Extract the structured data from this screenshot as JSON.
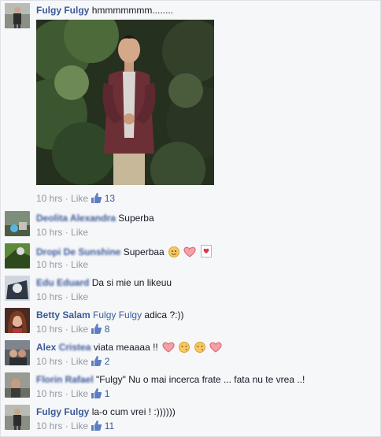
{
  "post": {
    "author": "Fulgy Fulgy",
    "text": "hmmmmmmm........",
    "time": "10 hrs",
    "sep": "·",
    "like_label": "Like",
    "like_count": "13"
  },
  "comments": [
    {
      "author": "Deolita Alexandra",
      "text": "Superba",
      "time": "10 hrs",
      "like_label": "Like",
      "like_count": ""
    },
    {
      "author": "Dropi De Sunshine",
      "text": "Superbaa",
      "time": "10 hrs",
      "like_label": "Like",
      "like_count": ""
    },
    {
      "author": "Edu Eduard",
      "text": "Da si mie un likeuu",
      "time": "10 hrs",
      "like_label": "Like",
      "like_count": ""
    },
    {
      "author": "Betty Salam",
      "mention": "Fulgy Fulgy",
      "text": "adica ?:))",
      "time": "10 hrs",
      "like_label": "Like",
      "like_count": "8"
    },
    {
      "author": "Alex Cristea",
      "text": "viata meaaaa !!",
      "time": "10 hrs",
      "like_label": "Like",
      "like_count": "2"
    },
    {
      "author": "Florin Rafael",
      "text": "\"Fulgy\" Nu o mai incerca frate ... fata nu te vrea ..!",
      "time": "10 hrs",
      "like_label": "Like",
      "like_count": "1"
    },
    {
      "author": "Fulgy Fulgy",
      "text": "la-o cum vrei ! :))))))",
      "time": "10 hrs",
      "like_label": "Like",
      "like_count": "11"
    }
  ],
  "colors": {
    "link": "#3b5998",
    "meta": "#9197a3",
    "bg": "#f6f7f9",
    "heart": "#f2a1a8"
  },
  "icons": [
    "thumbs-up-icon",
    "smiley-icon",
    "heart-icon",
    "kiss-emoji-icon",
    "card-heart-icon"
  ]
}
